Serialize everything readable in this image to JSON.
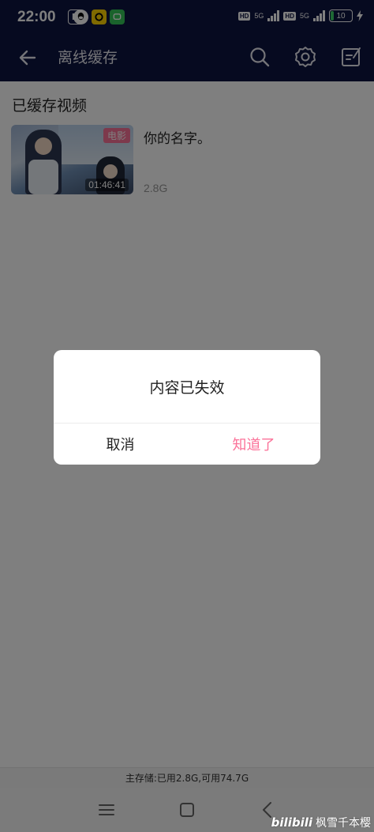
{
  "status_bar": {
    "time": "22:00",
    "hd1": "HD",
    "net1": "5G",
    "hd2": "HD",
    "net2": "5G",
    "battery": "10"
  },
  "header": {
    "title": "离线缓存"
  },
  "content": {
    "section_title": "已缓存视频",
    "videos": [
      {
        "title": "你的名字。",
        "badge": "电影",
        "duration": "01:46:41",
        "size": "2.8G"
      }
    ]
  },
  "storage": {
    "text": "主存储:已用2.8G,可用74.7G"
  },
  "dialog": {
    "message": "内容已失效",
    "cancel_label": "取消",
    "ok_label": "知道了"
  },
  "watermark": {
    "logo": "bilibili",
    "author": "枫雪千本樱"
  },
  "colors": {
    "header_bg": "#0d1540",
    "accent_pink": "#fb7299",
    "overlay": "rgba(0,0,0,0.5)"
  },
  "icons": {
    "back": "arrow-left-icon",
    "search": "search-icon",
    "settings": "gear-icon",
    "edit": "edit-icon",
    "nav_menu": "menu-icon",
    "nav_home": "home-icon",
    "nav_back": "chevron-left-icon"
  }
}
